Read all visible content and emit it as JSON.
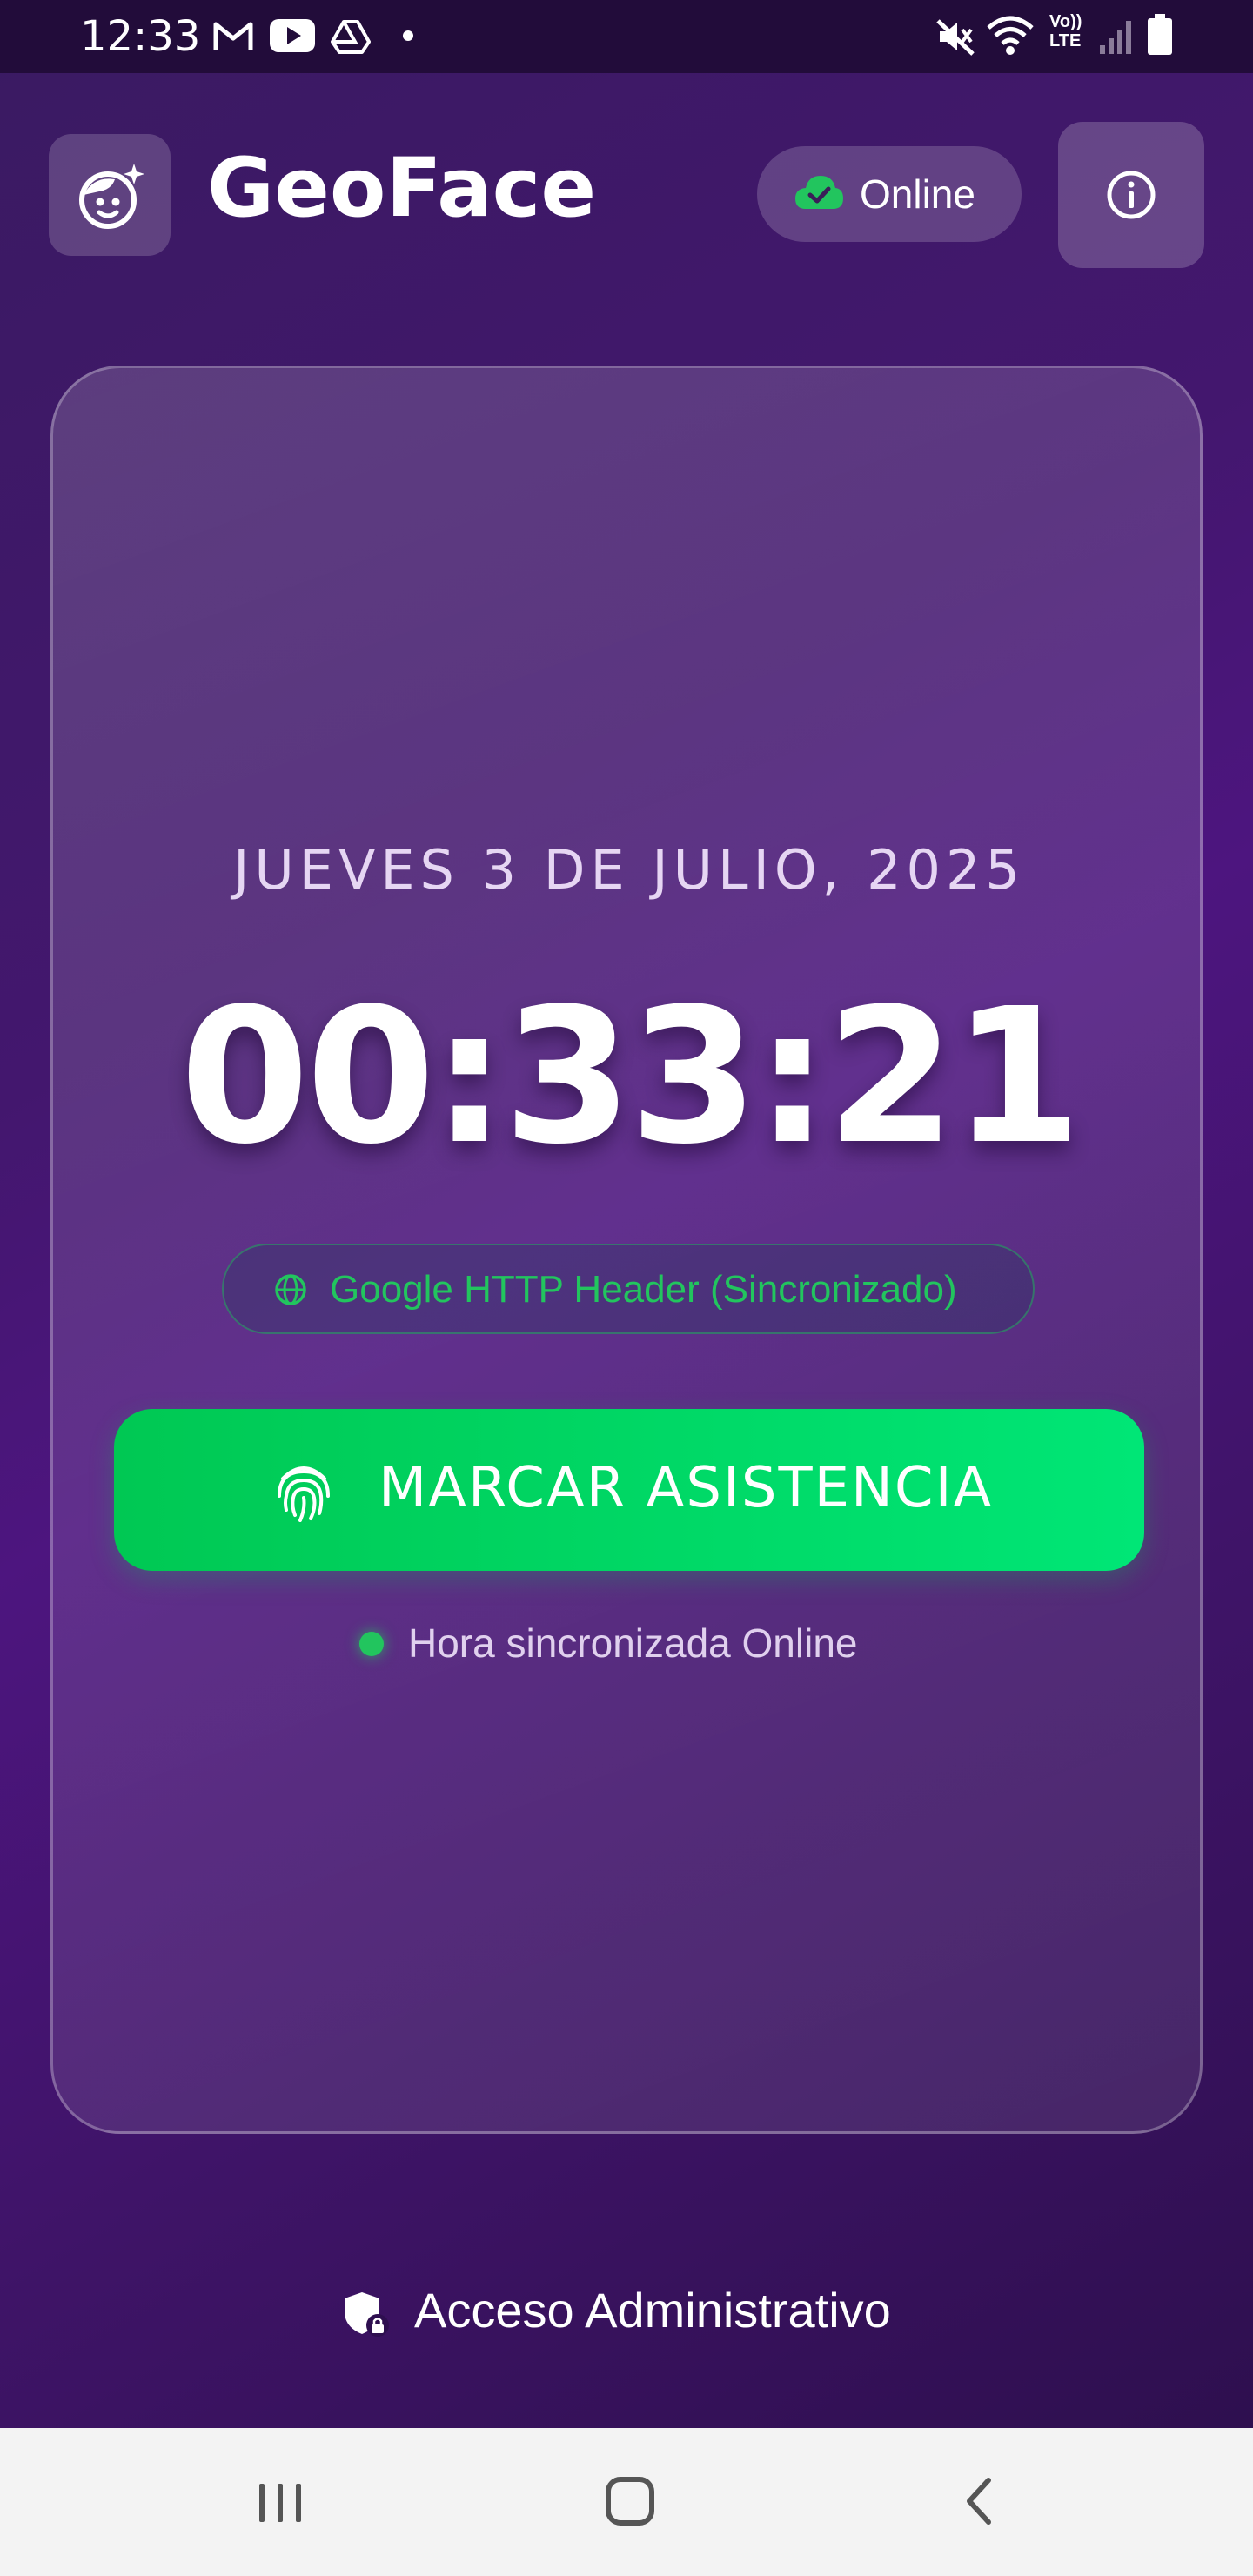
{
  "status_bar": {
    "time": "12:33",
    "left_icons": [
      "gmail-icon",
      "youtube-icon",
      "drive-icon",
      "dot-icon"
    ],
    "right_icons": [
      "mute-icon",
      "wifi-icon",
      "volte-icon",
      "signal-icon",
      "battery-icon"
    ],
    "volte_line1": "Vo))",
    "volte_line2": "LTE"
  },
  "header": {
    "logo_icon": "face-sparkle-icon",
    "title": "GeoFace",
    "status_badge": {
      "label": "Online",
      "icon": "cloud-check-icon",
      "icon_color": "#22c55e"
    },
    "info_button_icon": "info-icon"
  },
  "clock_card": {
    "date": "JUEVES 3 DE JULIO, 2025",
    "time": "00:33:21",
    "time_source": {
      "label": "Google HTTP Header (Sincronizado)",
      "icon": "globe-icon",
      "color": "#22c55e"
    },
    "mark_button": {
      "label": "MARCAR ASISTENCIA",
      "icon": "fingerprint-icon",
      "color": "#00e676"
    },
    "sync_status": {
      "label": "Hora sincronizada Online",
      "dot_color": "#22c55e"
    }
  },
  "admin_access": {
    "label": "Acceso Administrativo",
    "icon": "shield-lock-icon"
  },
  "nav_bar": {
    "buttons": [
      "recent-apps-icon",
      "home-icon",
      "back-icon"
    ]
  }
}
